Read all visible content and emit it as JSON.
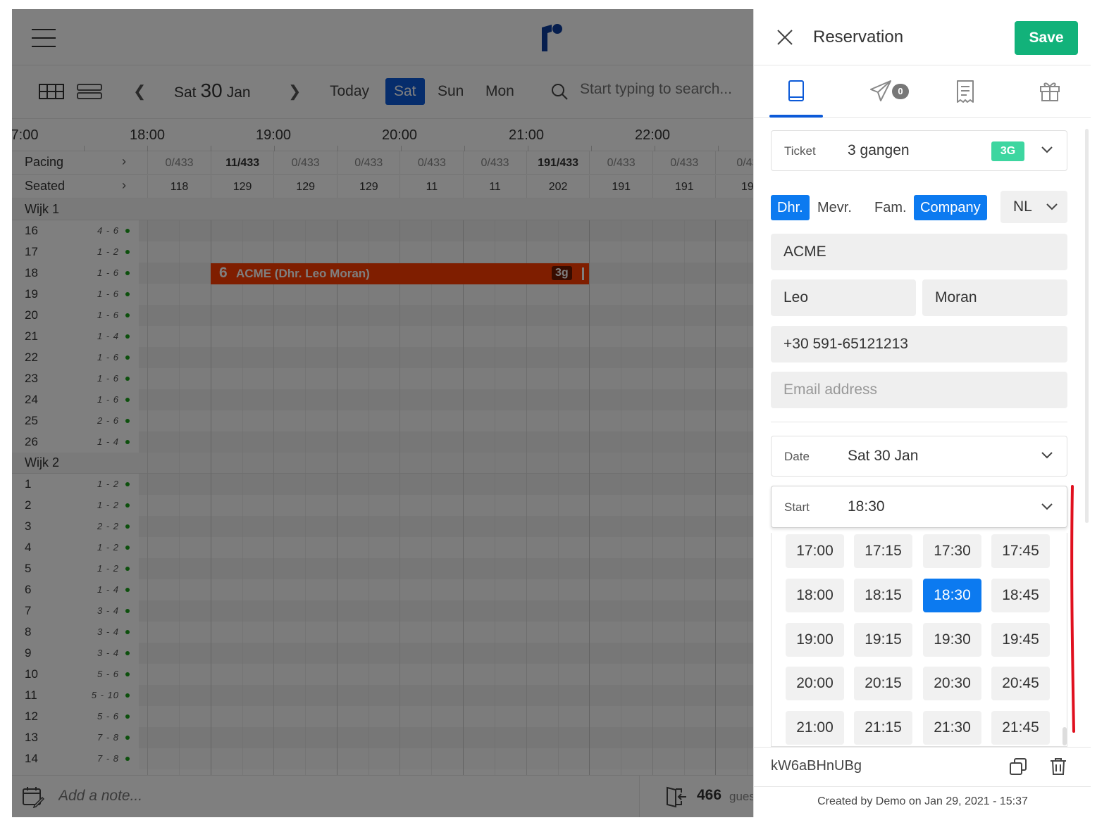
{
  "schedule": {
    "date": {
      "weekday": "Sat",
      "day": "30",
      "month": "Jan"
    },
    "nav": {
      "today": "Today",
      "days": [
        "Sat",
        "Sun",
        "Mon"
      ],
      "active_day": "Sat"
    },
    "search": {
      "placeholder": "Start typing to search..."
    },
    "timeline": [
      "7:00",
      "18:00",
      "19:00",
      "20:00",
      "21:00",
      "22:00"
    ],
    "pacing": {
      "label": "Pacing",
      "values": [
        "0/433",
        "11/433",
        "0/433",
        "0/433",
        "0/433",
        "0/433",
        "191/433",
        "0/433",
        "0/433",
        "0/43"
      ]
    },
    "seated": {
      "label": "Seated",
      "values": [
        "118",
        "129",
        "129",
        "129",
        "11",
        "11",
        "202",
        "191",
        "191",
        "19"
      ]
    },
    "sections": [
      {
        "name": "Wijk 1",
        "tables": [
          {
            "num": "16",
            "cap": "4 - 6"
          },
          {
            "num": "17",
            "cap": "1 - 2"
          },
          {
            "num": "18",
            "cap": "1 - 6"
          },
          {
            "num": "19",
            "cap": "1 - 6"
          },
          {
            "num": "20",
            "cap": "1 - 6"
          },
          {
            "num": "21",
            "cap": "1 - 4"
          },
          {
            "num": "22",
            "cap": "1 - 6"
          },
          {
            "num": "23",
            "cap": "1 - 6"
          },
          {
            "num": "24",
            "cap": "1 - 6"
          },
          {
            "num": "25",
            "cap": "2 - 6"
          },
          {
            "num": "26",
            "cap": "1 - 4"
          }
        ]
      },
      {
        "name": "Wijk 2",
        "tables": [
          {
            "num": "1",
            "cap": "1 - 2"
          },
          {
            "num": "2",
            "cap": "1 - 2"
          },
          {
            "num": "3",
            "cap": "2 - 2"
          },
          {
            "num": "4",
            "cap": "1 - 2"
          },
          {
            "num": "5",
            "cap": "1 - 2"
          },
          {
            "num": "6",
            "cap": "1 - 4"
          },
          {
            "num": "7",
            "cap": "3 - 4"
          },
          {
            "num": "8",
            "cap": "3 - 4"
          },
          {
            "num": "9",
            "cap": "3 - 4"
          },
          {
            "num": "10",
            "cap": "5 - 6"
          },
          {
            "num": "11",
            "cap": "5 - 10"
          },
          {
            "num": "12",
            "cap": "5 - 6"
          },
          {
            "num": "13",
            "cap": "7 - 8"
          },
          {
            "num": "14",
            "cap": "7 - 8"
          }
        ]
      }
    ],
    "reservation_bar": {
      "count": "6",
      "name": "ACME (Dhr. Leo Moran)",
      "badge": "3g"
    },
    "footer": {
      "note_placeholder": "Add a note...",
      "guest_count": "466",
      "guest_label": "gues"
    }
  },
  "panel": {
    "title": "Reservation",
    "save_label": "Save",
    "tab_badge": "0",
    "ticket": {
      "label": "Ticket",
      "value": "3 gangen",
      "badge": "3G"
    },
    "salutations": [
      "Dhr.",
      "Mevr.",
      "Fam.",
      "Company"
    ],
    "active_salutations": [
      "Dhr.",
      "Company"
    ],
    "language": "NL",
    "company": "ACME",
    "first_name": "Leo",
    "last_name": "Moran",
    "phone": "+30 591-65121213",
    "email_placeholder": "Email address",
    "date": {
      "label": "Date",
      "value": "Sat 30 Jan"
    },
    "start": {
      "label": "Start",
      "value": "18:30"
    },
    "times": [
      "17:00",
      "17:15",
      "17:30",
      "17:45",
      "18:00",
      "18:15",
      "18:30",
      "18:45",
      "19:00",
      "19:15",
      "19:30",
      "19:45",
      "20:00",
      "20:15",
      "20:30",
      "20:45",
      "21:00",
      "21:15",
      "21:30",
      "21:45"
    ],
    "selected_time": "18:30",
    "code": "kW6aBHnUBg",
    "created": "Created by Demo on Jan 29, 2021 - 15:37"
  },
  "colors": {
    "accent": "#0c5ad8",
    "save": "#12b27a",
    "reservation": "#ff3c00",
    "badge_3g": "#3dd6a0",
    "selected": "#0c7af0"
  }
}
